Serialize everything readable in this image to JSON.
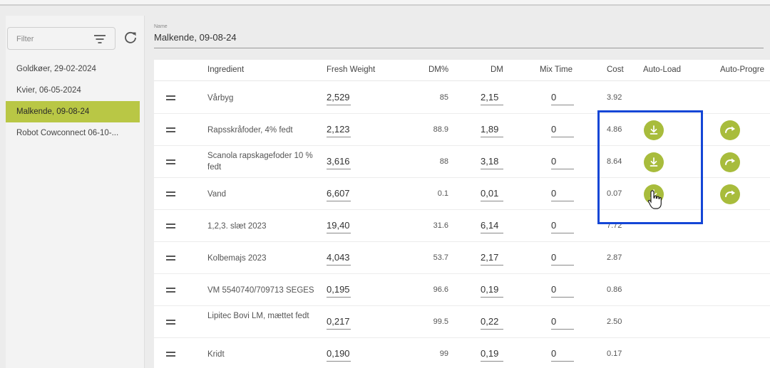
{
  "sidebar": {
    "filter_placeholder": "Filter",
    "items": [
      {
        "label": "Goldkøer, 29-02-2024",
        "active": false
      },
      {
        "label": "Kvier, 06-05-2024",
        "active": false
      },
      {
        "label": "Malkende, 09-08-24",
        "active": true
      },
      {
        "label": "Robot Cowconnect 06-10-...",
        "active": false
      }
    ]
  },
  "name_field": {
    "label": "Name",
    "value": "Malkende, 09-08-24"
  },
  "table": {
    "headers": {
      "ingredient": "Ingredient",
      "fresh_weight": "Fresh Weight",
      "dm_pct": "DM%",
      "dm": "DM",
      "mix_time": "Mix Time",
      "cost": "Cost",
      "auto_load": "Auto-Load",
      "auto_progress": "Auto-Progre"
    },
    "rows": [
      {
        "ingredient": "Vårbyg",
        "fresh_weight": "2,529",
        "dm_pct": "85",
        "dm": "2,15",
        "mix_time": "0",
        "cost": "3.92",
        "auto_load": false,
        "auto_progress": false
      },
      {
        "ingredient": "Rapsskråfoder, 4% fedt",
        "fresh_weight": "2,123",
        "dm_pct": "88.9",
        "dm": "1,89",
        "mix_time": "0",
        "cost": "4.86",
        "auto_load": true,
        "auto_progress": true
      },
      {
        "ingredient": "Scanola rapskagefoder 10 % fedt",
        "fresh_weight": "3,616",
        "dm_pct": "88",
        "dm": "3,18",
        "mix_time": "0",
        "cost": "8.64",
        "auto_load": true,
        "auto_progress": true
      },
      {
        "ingredient": "Vand",
        "fresh_weight": "6,607",
        "dm_pct": "0.1",
        "dm": "0,01",
        "mix_time": "0",
        "cost": "0.07",
        "auto_load": true,
        "auto_progress": true
      },
      {
        "ingredient": "1,2,3. slæt 2023",
        "fresh_weight": "19,40",
        "dm_pct": "31.6",
        "dm": "6,14",
        "mix_time": "0",
        "cost": "7.72",
        "auto_load": false,
        "auto_progress": false
      },
      {
        "ingredient": "Kolbemajs 2023",
        "fresh_weight": "4,043",
        "dm_pct": "53.7",
        "dm": "2,17",
        "mix_time": "0",
        "cost": "2.87",
        "auto_load": false,
        "auto_progress": false
      },
      {
        "ingredient": "VM 5540740/709713 SEGES",
        "fresh_weight": "0,195",
        "dm_pct": "96.6",
        "dm": "0,19",
        "mix_time": "0",
        "cost": "0.86",
        "auto_load": false,
        "auto_progress": false
      },
      {
        "ingredient": "Lipitec Bovi LM, mættet fedt",
        "fresh_weight": "0,217",
        "dm_pct": "99.5",
        "dm": "0,22",
        "mix_time": "0",
        "cost": "2.50",
        "auto_load": false,
        "auto_progress": false
      },
      {
        "ingredient": "Kridt",
        "fresh_weight": "0,190",
        "dm_pct": "99",
        "dm": "0,19",
        "mix_time": "0",
        "cost": "0.17",
        "auto_load": false,
        "auto_progress": false
      }
    ]
  },
  "colors": {
    "accent_green": "#a8bc3c",
    "active_item": "#b9c745",
    "highlight_box": "#1446d6"
  },
  "icons": {
    "filter": "filter-icon",
    "refresh": "refresh-icon",
    "drag": "drag-handle-icon",
    "auto_load": "download-icon",
    "auto_progress": "forward-arrow-icon"
  }
}
